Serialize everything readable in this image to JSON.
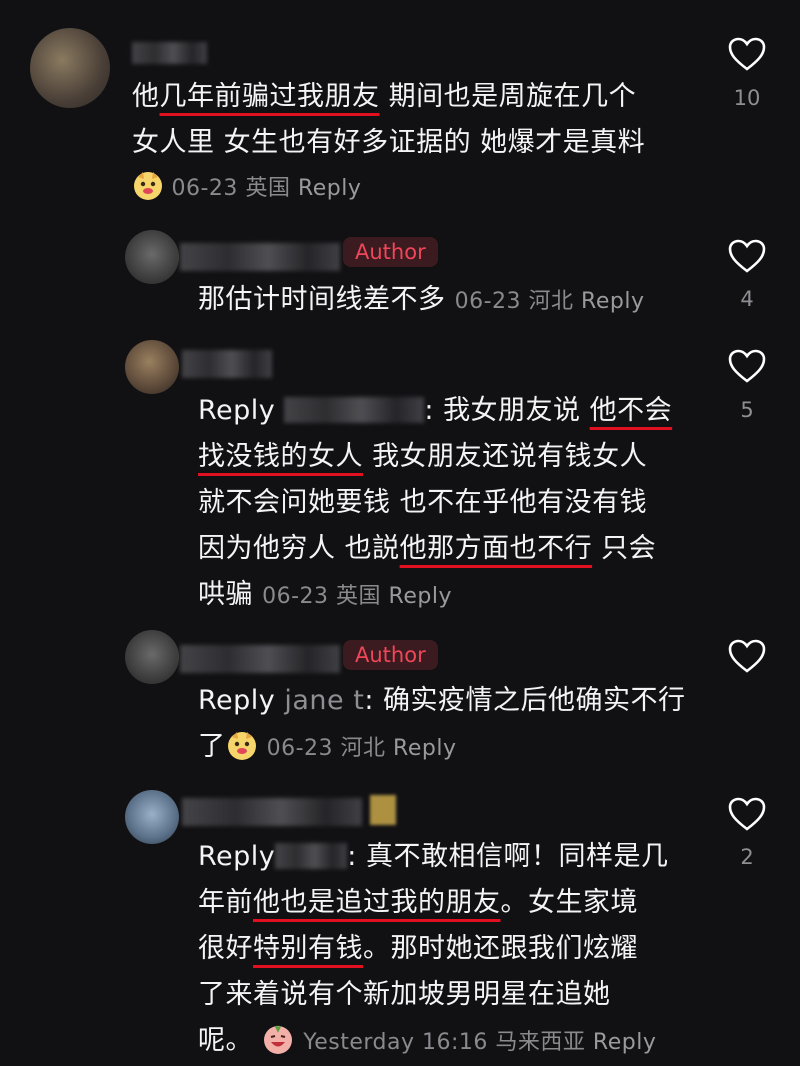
{
  "comments": [
    {
      "line1a": "他",
      "line1u": "几年前骗过我朋友",
      "line1b": " 期间也是周旋在几个",
      "line2": "女人里 女生也有好多证据的 她爆才是真料",
      "date": "06-23",
      "loc": "英国",
      "reply": "Reply",
      "likes": "10"
    },
    {
      "badge": "Author",
      "text": "那估计时间线差不多",
      "date": "06-23",
      "loc": "河北",
      "reply": "Reply",
      "likes": "4"
    },
    {
      "prefix": "Reply",
      "sep": ": ",
      "l1a": "我女朋友说 ",
      "l1u": "他不会",
      "l2u": "找没钱的女人",
      "l2b": " 我女朋友还说有钱女人",
      "l3": "就不会问她要钱 也不在乎他有没有钱",
      "l4a": "因为他穷人 也説",
      "l4u": "他那方面也不行",
      "l4b": " 只会",
      "l5": "哄骗",
      "date": "06-23",
      "loc": "英国",
      "reply": "Reply",
      "likes": "5"
    },
    {
      "badge": "Author",
      "prefix": "Reply",
      "user": "jane t",
      "sep": ": ",
      "l1": "确实疫情之后他确实不行",
      "l2": "了",
      "date": "06-23",
      "loc": "河北",
      "reply": "Reply"
    },
    {
      "prefix": "Reply",
      "sep": ": ",
      "l1": "真不敢相信啊！同样是几",
      "l2a": "年前",
      "l2u": "他也是追过我的朋友",
      "l2b": "。女生家境",
      "l3a": "很好",
      "l3u": "特别有钱",
      "l3b": "。那时她还跟我们炫耀",
      "l4": "了来着说有个新加坡男明星在追她",
      "l5": "呢。",
      "date": "Yesterday 16:16",
      "loc": "马来西亚",
      "reply": "Reply",
      "likes": "2"
    }
  ],
  "colors": {
    "background": "#111114",
    "author_badge": "#f0465a",
    "underline": "#e01020",
    "meta": "#8a8a8e"
  },
  "icons": {
    "like": "heart-outline-icon",
    "emoji1": "dog-emoji-icon",
    "emoji2": "laughing-emoji-icon"
  }
}
